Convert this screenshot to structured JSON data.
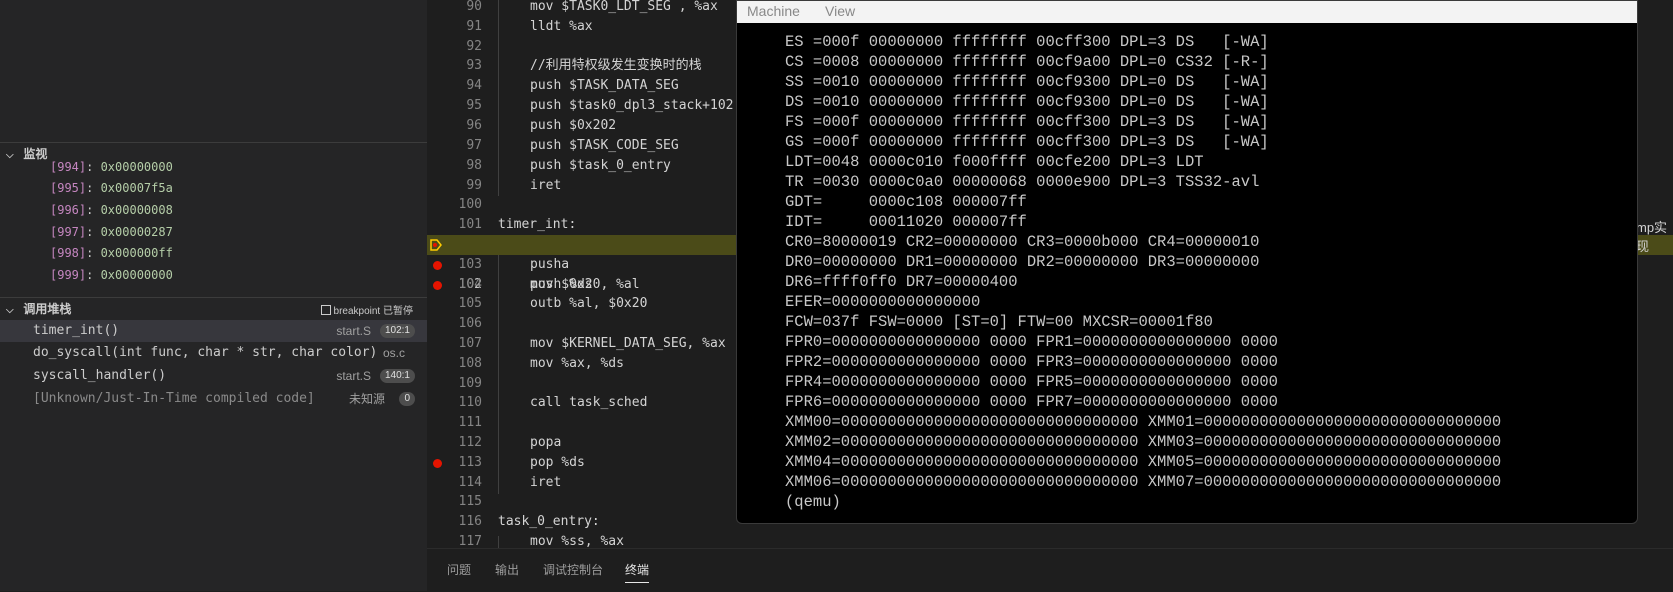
{
  "sidebar": {
    "watch_title": "监视",
    "watch_items": [
      {
        "index": "[994]",
        "value": "0x00000000"
      },
      {
        "index": "[995]",
        "value": "0x00007f5a"
      },
      {
        "index": "[996]",
        "value": "0x00000008"
      },
      {
        "index": "[997]",
        "value": "0x00000287"
      },
      {
        "index": "[998]",
        "value": "0x000000ff"
      },
      {
        "index": "[999]",
        "value": "0x00000000"
      }
    ],
    "callstack_title": "调用堆栈",
    "paused_label": "breakpoint 已暂停",
    "frames": [
      {
        "name": "timer_int()",
        "file": "start.S",
        "line": "102:1"
      },
      {
        "name": "do_syscall(int func, char * str, char color)",
        "file": "os.c",
        "line": ""
      },
      {
        "name": "syscall_handler()",
        "file": "start.S",
        "line": "140:1"
      },
      {
        "name": "[Unknown/Just-In-Time compiled code]",
        "file": "未知源",
        "line": "0"
      }
    ]
  },
  "editor": {
    "lines": [
      {
        "n": "90",
        "text": "mov $TASK0_LDT_SEG , %ax"
      },
      {
        "n": "91",
        "text": "lldt %ax"
      },
      {
        "n": "92",
        "text": ""
      },
      {
        "n": "93",
        "text": "//利用特权级发生变换时的栈"
      },
      {
        "n": "94",
        "text": "push $TASK_DATA_SEG"
      },
      {
        "n": "95",
        "text": "push $task0_dpl3_stack+102"
      },
      {
        "n": "96",
        "text": "push $0x202"
      },
      {
        "n": "97",
        "text": "push $TASK_CODE_SEG"
      },
      {
        "n": "98",
        "text": "push $task_0_entry"
      },
      {
        "n": "99",
        "text": "iret"
      },
      {
        "n": "100",
        "text": ""
      },
      {
        "n": "101",
        "text": "timer_int:"
      },
      {
        "n": "102",
        "text": "push %ds"
      },
      {
        "n": "103",
        "text": "pusha"
      },
      {
        "n": "104",
        "text": "mov $0x20, %al"
      },
      {
        "n": "105",
        "text": "outb %al, $0x20"
      },
      {
        "n": "106",
        "text": ""
      },
      {
        "n": "107",
        "text": "mov $KERNEL_DATA_SEG, %ax"
      },
      {
        "n": "108",
        "text": "mov %ax, %ds"
      },
      {
        "n": "109",
        "text": ""
      },
      {
        "n": "110",
        "text": "call task_sched"
      },
      {
        "n": "111",
        "text": ""
      },
      {
        "n": "112",
        "text": "popa"
      },
      {
        "n": "113",
        "text": "pop %ds"
      },
      {
        "n": "114",
        "text": "iret"
      },
      {
        "n": "115",
        "text": ""
      },
      {
        "n": "116",
        "text": "task_0_entry:"
      },
      {
        "n": "117",
        "text": "mov %ss, %ax"
      }
    ],
    "overflow_text": "mp实现"
  },
  "panel_tabs": [
    "问题",
    "输出",
    "调试控制台",
    "终端"
  ],
  "qemu": {
    "menu": [
      "Machine",
      "View"
    ],
    "lines": [
      "ES =000f 00000000 ffffffff 00cff300 DPL=3 DS   [-WA]",
      "CS =0008 00000000 ffffffff 00cf9a00 DPL=0 CS32 [-R-]",
      "SS =0010 00000000 ffffffff 00cf9300 DPL=0 DS   [-WA]",
      "DS =0010 00000000 ffffffff 00cf9300 DPL=0 DS   [-WA]",
      "FS =000f 00000000 ffffffff 00cff300 DPL=3 DS   [-WA]",
      "GS =000f 00000000 ffffffff 00cff300 DPL=3 DS   [-WA]",
      "LDT=0048 0000c010 f000ffff 00cfe200 DPL=3 LDT",
      "TR =0030 0000c0a0 00000068 0000e900 DPL=3 TSS32-avl",
      "GDT=     0000c108 000007ff",
      "IDT=     00011020 000007ff",
      "CR0=80000019 CR2=00000000 CR3=0000b000 CR4=00000010",
      "DR0=00000000 DR1=00000000 DR2=00000000 DR3=00000000",
      "DR6=ffff0ff0 DR7=00000400",
      "EFER=0000000000000000",
      "FCW=037f FSW=0000 [ST=0] FTW=00 MXCSR=00001f80",
      "FPR0=0000000000000000 0000 FPR1=0000000000000000 0000",
      "FPR2=0000000000000000 0000 FPR3=0000000000000000 0000",
      "FPR4=0000000000000000 0000 FPR5=0000000000000000 0000",
      "FPR6=0000000000000000 0000 FPR7=0000000000000000 0000",
      "XMM00=00000000000000000000000000000000 XMM01=00000000000000000000000000000000",
      "XMM02=00000000000000000000000000000000 XMM03=00000000000000000000000000000000",
      "XMM04=00000000000000000000000000000000 XMM05=00000000000000000000000000000000",
      "XMM06=00000000000000000000000000000000 XMM07=00000000000000000000000000000000",
      "(qemu)"
    ]
  }
}
